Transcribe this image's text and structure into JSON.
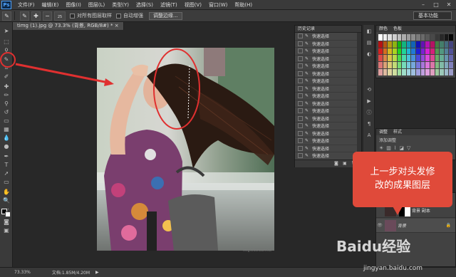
{
  "app": {
    "logo": "Ps",
    "menu": [
      "文件(F)",
      "编辑(E)",
      "图像(I)",
      "图层(L)",
      "类型(Y)",
      "选择(S)",
      "滤镜(T)",
      "视图(V)",
      "窗口(W)",
      "帮助(H)"
    ]
  },
  "options": {
    "size_value": "25",
    "sample_all_layers": "对所有图层取样",
    "auto_enhance": "自动增强",
    "refine_edge": "调整边缘...",
    "workspace": "基本功能"
  },
  "document": {
    "tab": "timg (1).jpg @ 73.3% (背景, RGB/8#) *",
    "caption": "img.tilisncom.ct"
  },
  "status": {
    "zoom": "73.33%",
    "doc_size": "文档:1.85M/4.20M"
  },
  "history": {
    "title": "历史记录",
    "items": [
      "快速选择",
      "快速选择",
      "快速选择",
      "快速选择",
      "快速选择",
      "快速选择",
      "快速选择",
      "快速选择",
      "快速选择",
      "快速选择",
      "快速选择",
      "快速选择",
      "快速选择",
      "快速选择",
      "快速选择",
      "快速选择",
      "快速选择",
      "快速选择"
    ],
    "selected_index": 17
  },
  "swatches": {
    "tabs": [
      "颜色",
      "色板"
    ]
  },
  "adjustments": {
    "tabs": [
      "调整",
      "样式"
    ],
    "title": "添加调整"
  },
  "layers": {
    "items": [
      {
        "name": "背景 副本",
        "visible": false
      },
      {
        "name": "背景",
        "visible": true
      }
    ]
  },
  "callout": {
    "line1": "上一步对头发修",
    "line2": "改的成果图层"
  },
  "watermark": {
    "brand": "Baidu经验",
    "url": "jingyan.baidu.com"
  },
  "colors": {
    "accent_red": "#e04a3a",
    "history_selected": "#5a7ea8"
  }
}
